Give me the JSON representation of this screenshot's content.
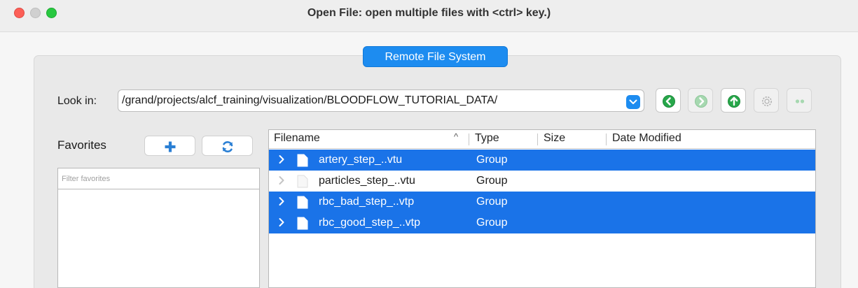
{
  "window": {
    "title": "Open File:  open multiple files with <ctrl> key.)"
  },
  "group": {
    "label": "Remote File System"
  },
  "lookin": {
    "label": "Look in:",
    "path": "/grand/projects/alcf_training/visualization/BLOODFLOW_TUTORIAL_DATA/"
  },
  "navigation": [
    {
      "name": "back",
      "icon": "arrow-left-icon",
      "enabled": true
    },
    {
      "name": "forward",
      "icon": "arrow-right-icon",
      "enabled": false
    },
    {
      "name": "up",
      "icon": "arrow-up-icon",
      "enabled": true
    },
    {
      "name": "settings",
      "icon": "gear-icon",
      "enabled": false
    },
    {
      "name": "navigate",
      "icon": "dots-icon",
      "enabled": false
    }
  ],
  "favorites": {
    "label": "Favorites",
    "add_icon": "plus-icon",
    "refresh_icon": "refresh-icon",
    "filter_placeholder": "Filter favorites"
  },
  "table": {
    "columns": [
      "Filename",
      "Type",
      "Size",
      "Date Modified"
    ],
    "sort_indicator": "^",
    "rows": [
      {
        "name": "artery_step_..vtu",
        "type": "Group",
        "selected": true
      },
      {
        "name": "particles_step_..vtu",
        "type": "Group",
        "selected": false
      },
      {
        "name": "rbc_bad_step_..vtp",
        "type": "Group",
        "selected": true
      },
      {
        "name": "rbc_good_step_..vtp",
        "type": "Group",
        "selected": true
      }
    ]
  },
  "colors": {
    "accent": "#1d8cf0",
    "selection": "#1a73e8",
    "nav_green": "#27a74a",
    "close": "#fc5f57",
    "maximize": "#28c840"
  }
}
